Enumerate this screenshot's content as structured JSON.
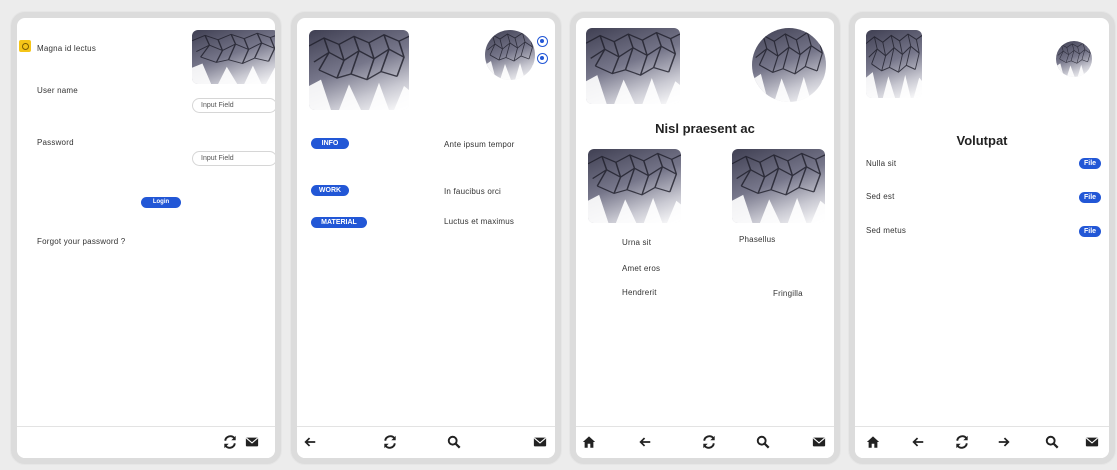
{
  "screen1": {
    "header_text": "Magna id lectus",
    "username_label": "User name",
    "username_placeholder": "Input Field",
    "password_label": "Password",
    "password_placeholder": "Input Field",
    "login_button": "Login",
    "forgot_link": "Forgot your password ?"
  },
  "screen2": {
    "rows": [
      {
        "tag": "INFO",
        "text": "Ante ipsum tempor"
      },
      {
        "tag": "WORK",
        "text": "In faucibus orci"
      },
      {
        "tag": "MATERIAL",
        "text": "Luctus et maximus"
      }
    ]
  },
  "screen3": {
    "title": "Nisl praesent ac",
    "items": [
      "Urna sit",
      "Phasellus",
      "Amet eros",
      "Hendrerit",
      "Fringilla"
    ]
  },
  "screen4": {
    "title": "Volutpat",
    "rows": [
      {
        "label": "Nulla sit",
        "button": "File"
      },
      {
        "label": "Sed est",
        "button": "File"
      },
      {
        "label": "Sed metus",
        "button": "File"
      }
    ]
  },
  "colors": {
    "accent": "#2257d6",
    "badge": "#f5c518",
    "frame": "#dcdcdc",
    "background": "#ececec"
  },
  "icons": {
    "refresh": "refresh-icon",
    "mail": "mail-icon",
    "back": "arrow-left-icon",
    "forward": "arrow-right-icon",
    "search": "search-icon",
    "home": "home-icon"
  }
}
